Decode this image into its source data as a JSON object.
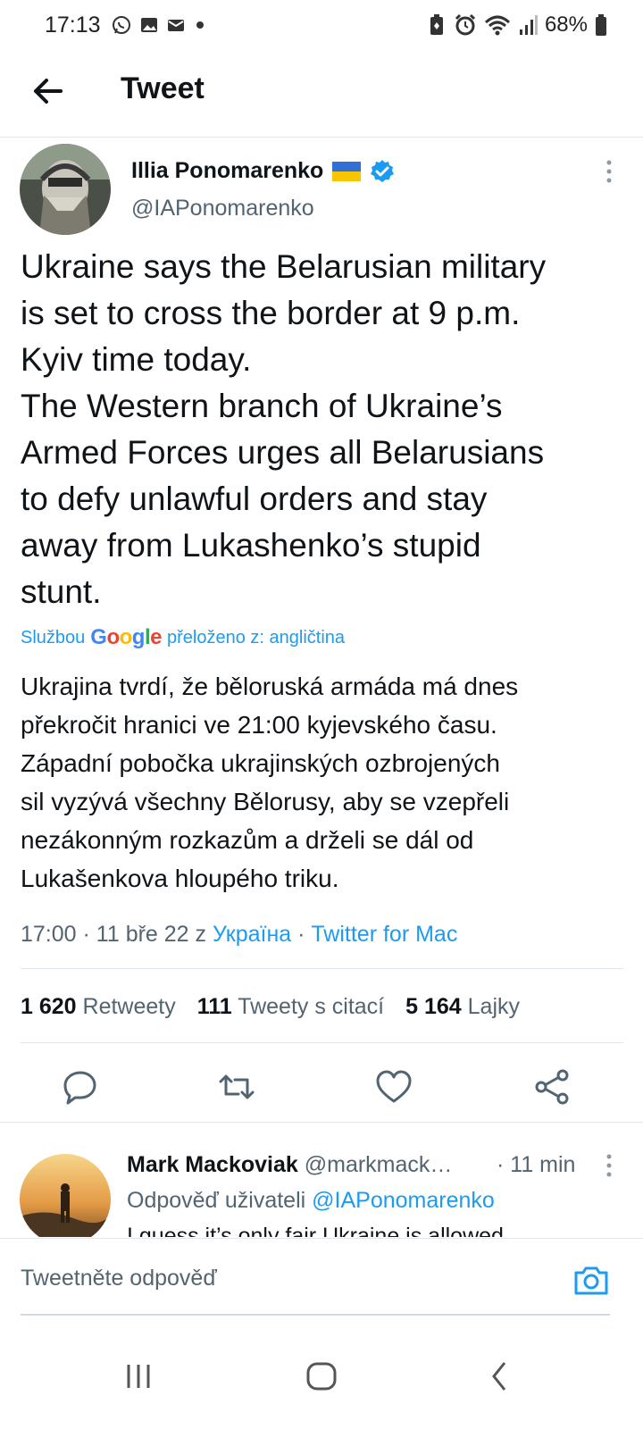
{
  "status_bar": {
    "time": "17:13",
    "battery": "68%",
    "left_icons": [
      "whatsapp-icon",
      "gallery-icon",
      "mail-icon",
      "dot-icon"
    ],
    "right_icons": [
      "battery-saver-icon",
      "alarm-icon",
      "wifi-icon",
      "signal-icon",
      "battery-icon"
    ]
  },
  "header": {
    "title": "Tweet",
    "back_icon": "arrow-left-icon"
  },
  "tweet": {
    "author_name": "Illia Ponomarenko",
    "author_handle": "@IAPonomarenko",
    "flag": "ukraine-flag",
    "verified": true,
    "text": "Ukraine says the Belarusian military\nis set to cross the border at 9 p.m.\nKyiv time today.\nThe Western branch of Ukraine’s\nArmed Forces urges all Belarusians\nto defy unlawful orders and stay\naway from Lukashenko’s stupid\nstunt.",
    "translation_prefix": "Službou",
    "translation_brand": "Google",
    "translation_suffix": "přeloženo z: angličtina",
    "translated_text": "Ukrajina tvrdí, že běloruská armáda má dnes\npřekročit hranici ve 21:00 kyjevského času.\n Západní pobočka ukrajinských ozbrojených\nsil vyzývá všechny Bělorusy, aby se vzepřeli\nnezákonným rozkazům a drželi se dál od\nLukašenkova hloupého triku.",
    "time": "17:00",
    "date": "11 bře 22",
    "from_word": "z",
    "location": "Україна",
    "source": "Twitter for Mac",
    "separator": "·"
  },
  "stats": {
    "retweets_count": "1 620",
    "retweets_label": "Retweety",
    "quotes_count": "111",
    "quotes_label": "Tweety s citací",
    "likes_count": "5 164",
    "likes_label": "Lajky"
  },
  "actions": [
    "reply-icon",
    "retweet-icon",
    "like-icon",
    "share-icon"
  ],
  "reply": {
    "name": "Mark Mackoviak",
    "handle": "@markmack…",
    "time": "· 11 min",
    "reply_to_label": "Odpověď uživateli",
    "reply_to_handle": "@IAPonomarenko",
    "text": "I guess it’s only fair Ukraine is allowed"
  },
  "compose": {
    "placeholder": "Tweetněte odpověď",
    "camera_icon": "camera-icon"
  },
  "colors": {
    "accent": "#1d9bf0",
    "secondary_text": "#536471",
    "primary_text": "#0f1419",
    "divider": "#e1e8ed"
  }
}
